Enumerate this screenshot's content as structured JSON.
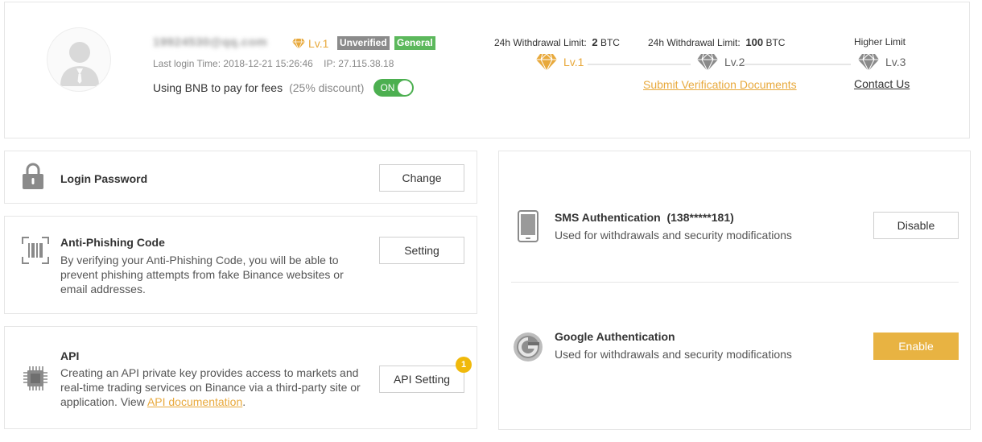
{
  "profile": {
    "email": "19924530@qq.com",
    "level": "Lv.1",
    "badges": {
      "unverified": "Unverified",
      "general": "General"
    },
    "last_login_label": "Last login Time:",
    "last_login_time": "2018-12-21 15:26:46",
    "ip_label": "IP:",
    "ip": "27.115.38.18",
    "bnb_label": "Using BNB to pay for fees",
    "bnb_discount": "(25% discount)",
    "bnb_toggle": "ON"
  },
  "limits": {
    "label": "24h Withdrawal Limit:",
    "lv1_amount": "2",
    "lv2_amount": "100",
    "currency": "BTC",
    "higher_label": "Higher Limit",
    "tiers": [
      "Lv.1",
      "Lv.2",
      "Lv.3"
    ],
    "submit_link": "Submit Verification Documents",
    "contact_link": "Contact Us"
  },
  "security": {
    "login_password": {
      "title": "Login Password",
      "button": "Change"
    },
    "anti_phishing": {
      "title": "Anti-Phishing Code",
      "desc": "By verifying your Anti-Phishing Code, you will be able to prevent phishing attempts from fake Binance websites or email addresses.",
      "button": "Setting"
    },
    "api": {
      "title": "API",
      "desc": "Creating an API private key provides access to markets and real-time trading services on Binance via a third-party site or application. View ",
      "doc_link": "API documentation",
      "desc_end": ".",
      "button": "API Setting",
      "notification_count": "1"
    },
    "sms": {
      "title": "SMS Authentication",
      "phone": "(138*****181)",
      "desc": "Used for withdrawals and security modifications",
      "button": "Disable"
    },
    "google": {
      "title": "Google Authentication",
      "desc": "Used for withdrawals and security modifications",
      "button": "Enable"
    }
  },
  "colors": {
    "accent": "#e8a93c",
    "enable_button": "#e8b342",
    "toggle_on": "#4caf50",
    "badge_unverified": "#8b8b8b",
    "badge_general": "#5cb85c",
    "notification": "#f0b90b"
  },
  "icons": {
    "avatar": "user-avatar-icon",
    "diamond": "diamond-icon",
    "lock": "lock-icon",
    "anti_phishing": "barcode-scan-icon",
    "api": "chip-icon",
    "sms": "phone-icon",
    "google": "google-authenticator-icon"
  }
}
